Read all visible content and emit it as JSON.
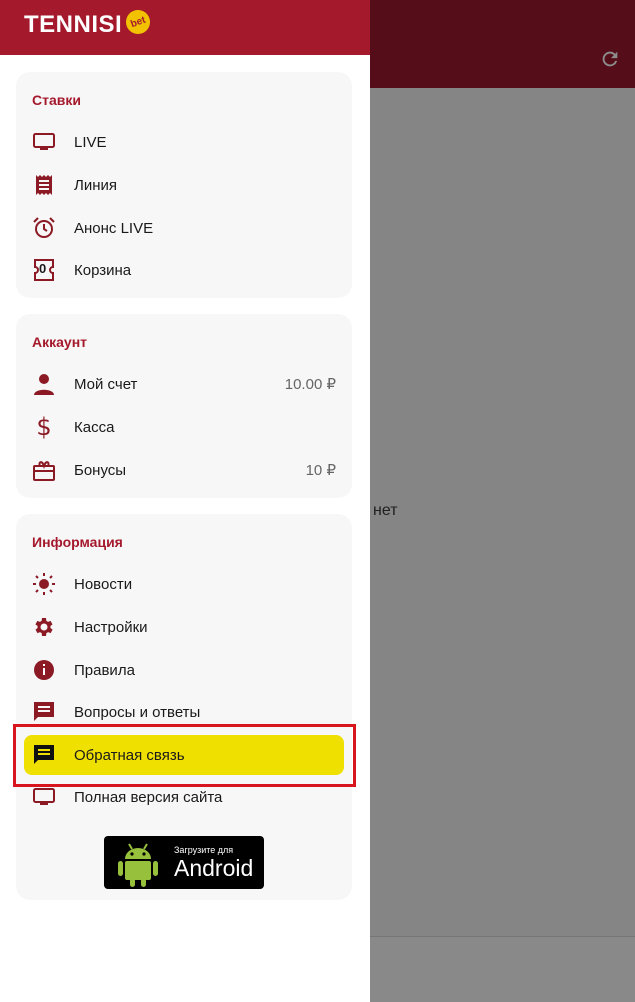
{
  "colors": {
    "brand_red": "#a5192c",
    "highlight_yellow": "#f0e000",
    "frame_red": "#d8141d",
    "icon_red": "#8b1a24"
  },
  "background": {
    "empty_text": "нет",
    "refresh_icon": "refresh-icon"
  },
  "header": {
    "logo_text": "TENNISI",
    "logo_badge": "bet"
  },
  "sections": {
    "bets": {
      "title": "Ставки",
      "items": [
        {
          "label": "LIVE",
          "icon": "tv-icon"
        },
        {
          "label": "Линия",
          "icon": "list-icon"
        },
        {
          "label": "Анонс LIVE",
          "icon": "alarm-icon"
        },
        {
          "label": "Корзина",
          "icon": "coupon-icon",
          "badge": "0"
        }
      ]
    },
    "account": {
      "title": "Аккаунт",
      "items": [
        {
          "label": "Мой счет",
          "icon": "person-icon",
          "value": "10.00 ₽"
        },
        {
          "label": "Касса",
          "icon": "dollar-icon",
          "value": ""
        },
        {
          "label": "Бонусы",
          "icon": "gift-icon",
          "value": "10 ₽"
        }
      ]
    },
    "info": {
      "title": "Информация",
      "items": [
        {
          "label": "Новости",
          "icon": "sun-icon"
        },
        {
          "label": "Настройки",
          "icon": "gear-icon"
        },
        {
          "label": "Правила",
          "icon": "info-icon"
        },
        {
          "label": "Вопросы и ответы",
          "icon": "chat-icon"
        },
        {
          "label": "Обратная связь",
          "icon": "feedback-icon"
        },
        {
          "label": "Полная версия сайта",
          "icon": "monitor-icon"
        }
      ]
    }
  },
  "android": {
    "small": "Загрузите для",
    "big": "Android"
  }
}
